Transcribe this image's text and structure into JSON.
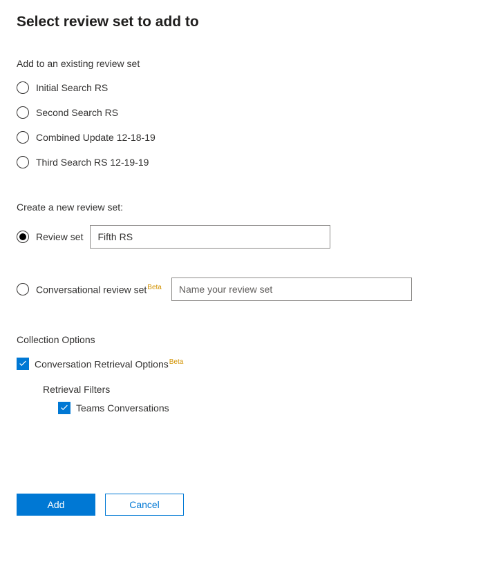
{
  "page_title": "Select review set to add to",
  "existing_section": {
    "label": "Add to an existing review set",
    "options": [
      {
        "label": "Initial Search RS"
      },
      {
        "label": "Second Search RS"
      },
      {
        "label": "Combined Update 12-18-19"
      },
      {
        "label": "Third Search RS 12-19-19"
      }
    ]
  },
  "create_section": {
    "label": "Create a new review set:",
    "review_set": {
      "label": "Review set",
      "value": "Fifth RS"
    },
    "conversational": {
      "label": "Conversational review set",
      "badge": "Beta",
      "placeholder": "Name your review set"
    }
  },
  "collection_section": {
    "label": "Collection Options",
    "conversation_retrieval": {
      "label": "Conversation Retrieval Options",
      "badge": "Beta"
    },
    "retrieval_filters": {
      "label": "Retrieval Filters",
      "teams": {
        "label": "Teams Conversations"
      }
    }
  },
  "buttons": {
    "add": "Add",
    "cancel": "Cancel"
  }
}
